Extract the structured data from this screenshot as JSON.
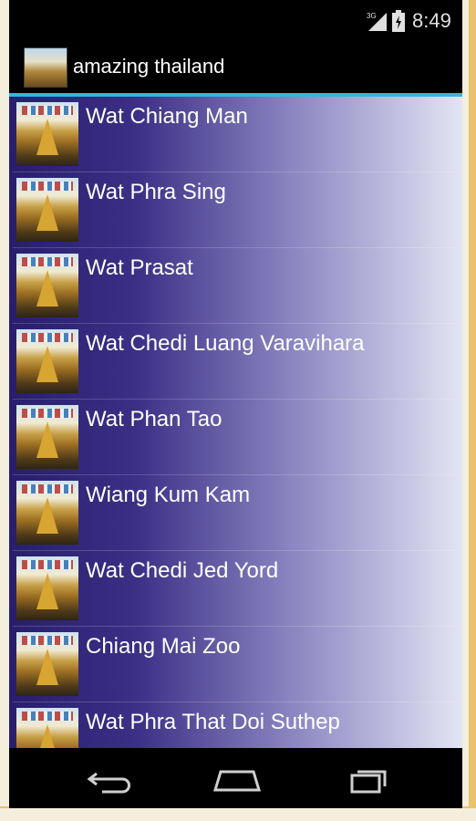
{
  "status_bar": {
    "network": "3G",
    "time": "8:49",
    "icons": [
      "signal-icon",
      "battery-icon"
    ]
  },
  "action_bar": {
    "title": "amazing thailand",
    "icon": "app-icon"
  },
  "list": {
    "items": [
      {
        "label": "Wat Chiang Man"
      },
      {
        "label": "Wat Phra Sing"
      },
      {
        "label": "Wat Prasat"
      },
      {
        "label": "Wat Chedi Luang Varavihara"
      },
      {
        "label": "Wat Phan Tao"
      },
      {
        "label": "Wiang Kum Kam"
      },
      {
        "label": "Wat Chedi Jed Yord"
      },
      {
        "label": "Chiang Mai Zoo"
      },
      {
        "label": "Wat Phra That Doi Suthep"
      }
    ]
  },
  "nav_bar": {
    "icons": [
      "back-icon",
      "home-icon",
      "recent-apps-icon"
    ]
  },
  "colors": {
    "accent": "#33b5e5",
    "list_gradient_start": "#281e6c",
    "list_gradient_end": "#e3e4f4"
  }
}
